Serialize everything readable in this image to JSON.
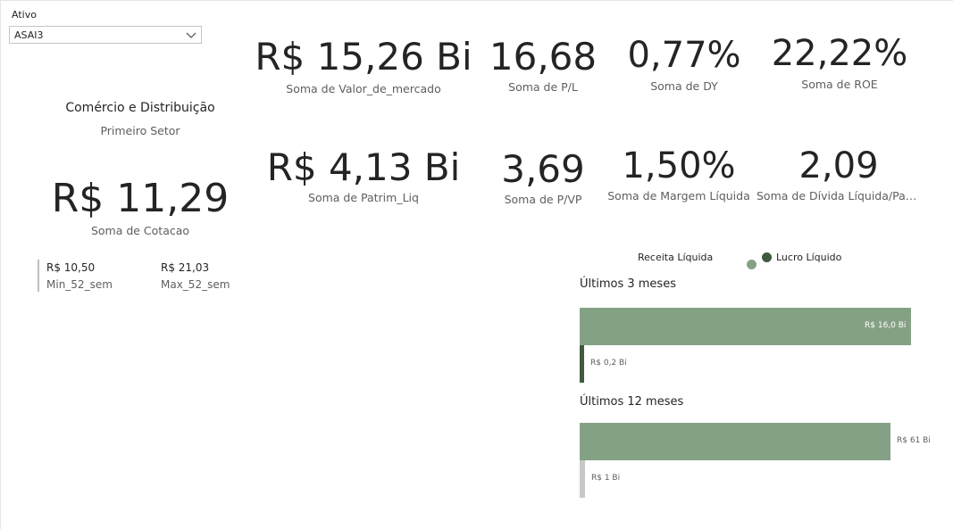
{
  "slicer": {
    "label": "Ativo",
    "value": "ASAI3"
  },
  "sector": {
    "name": "Comércio e Distribuição",
    "subtitle": "Primeiro Setor"
  },
  "price": {
    "value": "R$ 11,29",
    "label": "Soma de Cotacao"
  },
  "range52": {
    "min_value": "R$ 10,50",
    "min_label": "Min_52_sem",
    "max_value": "R$ 21,03",
    "max_label": "Max_52_sem"
  },
  "kpis": {
    "valor_mercado": {
      "value": "R$ 15,26 Bi",
      "label": "Soma de Valor_de_mercado"
    },
    "pl": {
      "value": "16,68",
      "label": "Soma de P/L"
    },
    "dy": {
      "value": "0,77%",
      "label": "Soma de DY"
    },
    "roe": {
      "value": "22,22%",
      "label": "Soma de ROE"
    },
    "patrim_liq": {
      "value": "R$ 4,13 Bi",
      "label": "Soma de Patrim_Liq"
    },
    "pvp": {
      "value": "3,69",
      "label": "Soma de P/VP"
    },
    "margem": {
      "value": "1,50%",
      "label": "Soma de Margem Líquida"
    },
    "divida": {
      "value": "2,09",
      "label": "Soma de Dívida Líquida/Patri..."
    }
  },
  "chart_data": {
    "type": "bar",
    "legend": [
      {
        "name": "Receita Líquida",
        "color": "#85a185"
      },
      {
        "name": "Lucro Líquido",
        "color": "#3f5a3f"
      }
    ],
    "sections": [
      {
        "title": "Últimos 3 meses",
        "revenue": 16.0,
        "revenue_label": "R$ 16,0 Bi",
        "profit": 0.2,
        "profit_label": "R$ 0,2 Bi",
        "xmax": 16.0
      },
      {
        "title": "Últimos 12 meses",
        "revenue": 61,
        "revenue_label": "R$ 61 Bi",
        "profit": 1,
        "profit_label": "R$ 1 Bi",
        "xmax": 65
      }
    ]
  },
  "colors": {
    "revenue": "#85a185",
    "profit": "#3f5a3f",
    "profit_light": "#c8c8c8"
  }
}
